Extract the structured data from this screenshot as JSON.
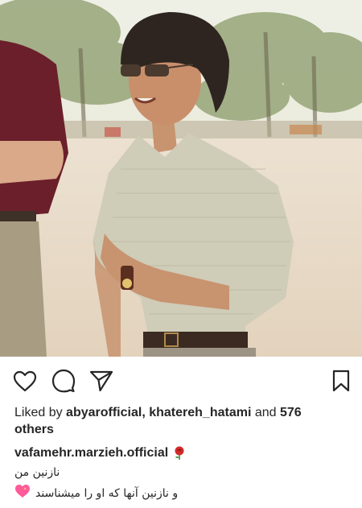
{
  "post": {
    "liked_by_prefix": "Liked by",
    "liked_user_1": "abyarofficial",
    "separator": ",",
    "liked_user_2": "khatereh_hatami",
    "and_text": "and",
    "others_count": "576",
    "others_text": "others",
    "caption": {
      "username": "vafamehr.marzieh.official",
      "line1": "نازنین من",
      "line2": "و نازنین آنها که او را میشناسند"
    },
    "icons": {
      "like": "heart-icon",
      "comment": "comment-icon",
      "share": "paper-plane-icon",
      "save": "bookmark-icon",
      "emoji_rose": "rose-emoji-icon",
      "emoji_heart": "sparkling-heart-emoji-icon"
    },
    "colors": {
      "text": "#262626",
      "sand": "#e9dccb",
      "shirt": "#c9c6b2",
      "rose": "#d32a2a",
      "heart": "#ff5a9a"
    }
  }
}
